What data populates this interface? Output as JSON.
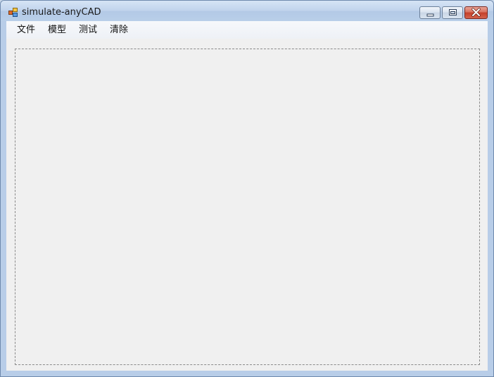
{
  "window": {
    "title": "simulate-anyCAD",
    "icon": "app-icon",
    "controls": [
      "minimize-icon",
      "maximize-icon",
      "close-icon"
    ]
  },
  "menu": {
    "items": [
      {
        "label": "文件"
      },
      {
        "label": "模型"
      },
      {
        "label": "测试"
      },
      {
        "label": "清除"
      }
    ]
  },
  "colors": {
    "titlebar": "#c0d3ec",
    "client": "#f0f0f0",
    "close_button": "#c4402a",
    "panel_border": "#8a8a8a"
  }
}
